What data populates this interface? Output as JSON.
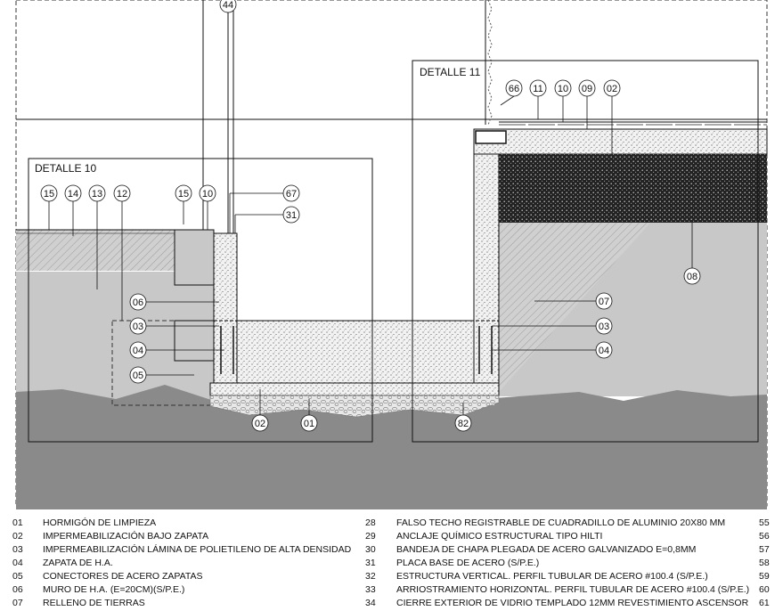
{
  "details": [
    {
      "title": "DETALLE 10"
    },
    {
      "title": "DETALLE 11"
    }
  ],
  "tags": {
    "t44": "44",
    "t66": "66",
    "t11a": "11",
    "t10a": "10",
    "t09": "09",
    "t02a": "02",
    "t15a": "15",
    "t14": "14",
    "t13": "13",
    "t12": "12",
    "t15b": "15",
    "t10b": "10",
    "t67": "67",
    "t31": "31",
    "t06": "06",
    "t03a": "03",
    "t04a": "04",
    "t05": "05",
    "t02b": "02",
    "t01": "01",
    "t08": "08",
    "t07": "07",
    "t03b": "03",
    "t04b": "04",
    "t82": "82"
  },
  "legend": [
    {
      "n1": "01",
      "t1": "HORMIGÓN DE LIMPIEZA",
      "n2": "28",
      "t2": "FALSO TECHO REGISTRABLE DE CUADRADILLO DE ALUMINIO 20X80 MM",
      "n3": "55"
    },
    {
      "n1": "02",
      "t1": "IMPERMEABILIZACIÓN BAJO ZAPATA",
      "n2": "29",
      "t2": "ANCLAJE QUÍMICO ESTRUCTURAL TIPO HILTI",
      "n3": "56"
    },
    {
      "n1": "03",
      "t1": "IMPERMEABILIZACIÓN LÁMINA DE POLIETILENO DE ALTA DENSIDAD",
      "n2": "30",
      "t2": "BANDEJA DE CHAPA PLEGADA DE ACERO GALVANIZADO E=0,8MM",
      "n3": "57"
    },
    {
      "n1": "04",
      "t1": "ZAPATA DE H.A.",
      "n2": "31",
      "t2": "PLACA BASE DE ACERO (S/P.E.)",
      "n3": "58"
    },
    {
      "n1": "05",
      "t1": "CONECTORES DE ACERO ZAPATAS",
      "n2": "32",
      "t2": "ESTRUCTURA VERTICAL. PERFIL TUBULAR DE ACERO #100.4 (S/P.E.)",
      "n3": "59"
    },
    {
      "n1": "06",
      "t1": "MURO DE H.A. (E=20CM)(S/P.E.)",
      "n2": "33",
      "t2": "ARRIOSTRAMIENTO HORIZONTAL. PERFIL TUBULAR DE ACERO #100.4 (S/P.E.)",
      "n3": "60"
    },
    {
      "n1": "07",
      "t1": "RELLENO DE TIERRAS",
      "n2": "34",
      "t2": "CIERRE EXTERIOR DE VIDRIO TEMPLADO 12MM REVESTIMIENTO ASCENSOR",
      "n3": "61"
    }
  ],
  "colors": {
    "background": "#ffffff",
    "terrain": "#c8c8c8",
    "ground": "#8a8a8a",
    "line": "#111111"
  }
}
